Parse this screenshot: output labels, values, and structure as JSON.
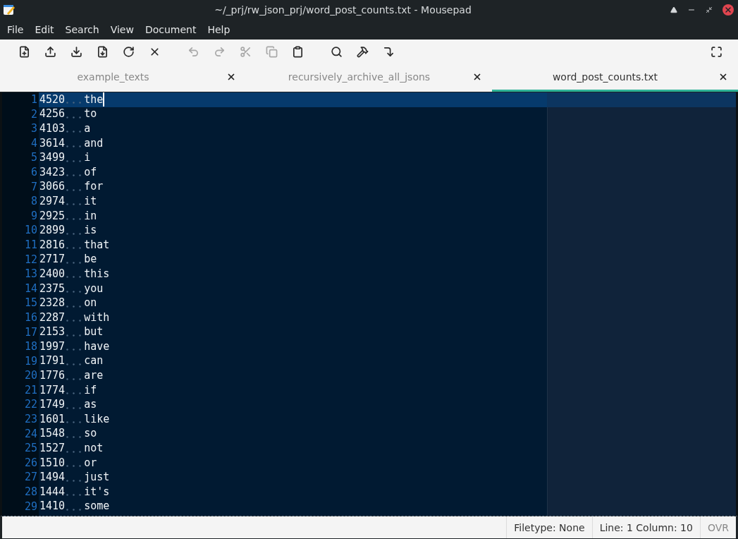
{
  "window": {
    "title": "~/_prj/rw_json_prj/word_post_counts.txt - Mousepad"
  },
  "menu": [
    "File",
    "Edit",
    "Search",
    "View",
    "Document",
    "Help"
  ],
  "toolbar": {
    "groups": [
      [
        {
          "disabled": false
        },
        {
          "disabled": false
        },
        {
          "disabled": false
        },
        {
          "disabled": false
        },
        {
          "disabled": false
        },
        {
          "disabled": false
        }
      ],
      [
        {
          "disabled": true
        },
        {
          "disabled": true
        },
        {
          "disabled": true
        },
        {
          "disabled": true
        },
        {
          "disabled": false
        }
      ],
      [
        {
          "disabled": false
        },
        {
          "disabled": false
        },
        {
          "disabled": false
        }
      ]
    ]
  },
  "tabs": [
    {
      "label": "example_texts",
      "selected": false
    },
    {
      "label": "recursively_archive_all_jsons",
      "selected": false
    },
    {
      "label": "word_post_counts.txt",
      "selected": true
    }
  ],
  "lines": [
    {
      "number": "1",
      "count": "4520",
      "word": "the",
      "current": true
    },
    {
      "number": "2",
      "count": "4256",
      "word": "to",
      "current": false
    },
    {
      "number": "3",
      "count": "4103",
      "word": "a",
      "current": false
    },
    {
      "number": "4",
      "count": "3614",
      "word": "and",
      "current": false
    },
    {
      "number": "5",
      "count": "3499",
      "word": "i",
      "current": false
    },
    {
      "number": "6",
      "count": "3423",
      "word": "of",
      "current": false
    },
    {
      "number": "7",
      "count": "3066",
      "word": "for",
      "current": false
    },
    {
      "number": "8",
      "count": "2974",
      "word": "it",
      "current": false
    },
    {
      "number": "9",
      "count": "2925",
      "word": "in",
      "current": false
    },
    {
      "number": "10",
      "count": "2899",
      "word": "is",
      "current": false
    },
    {
      "number": "11",
      "count": "2816",
      "word": "that",
      "current": false
    },
    {
      "number": "12",
      "count": "2717",
      "word": "be",
      "current": false
    },
    {
      "number": "13",
      "count": "2400",
      "word": "this",
      "current": false
    },
    {
      "number": "14",
      "count": "2375",
      "word": "you",
      "current": false
    },
    {
      "number": "15",
      "count": "2328",
      "word": "on",
      "current": false
    },
    {
      "number": "16",
      "count": "2287",
      "word": "with",
      "current": false
    },
    {
      "number": "17",
      "count": "2153",
      "word": "but",
      "current": false
    },
    {
      "number": "18",
      "count": "1997",
      "word": "have",
      "current": false
    },
    {
      "number": "19",
      "count": "1791",
      "word": "can",
      "current": false
    },
    {
      "number": "20",
      "count": "1776",
      "word": "are",
      "current": false
    },
    {
      "number": "21",
      "count": "1774",
      "word": "if",
      "current": false
    },
    {
      "number": "22",
      "count": "1749",
      "word": "as",
      "current": false
    },
    {
      "number": "23",
      "count": "1601",
      "word": "like",
      "current": false
    },
    {
      "number": "24",
      "count": "1548",
      "word": "so",
      "current": false
    },
    {
      "number": "25",
      "count": "1527",
      "word": "not",
      "current": false
    },
    {
      "number": "26",
      "count": "1510",
      "word": "or",
      "current": false
    },
    {
      "number": "27",
      "count": "1494",
      "word": "just",
      "current": false
    },
    {
      "number": "28",
      "count": "1444",
      "word": "it's",
      "current": false
    },
    {
      "number": "29",
      "count": "1410",
      "word": "some",
      "current": false
    }
  ],
  "status_bar": {
    "filetype": "Filetype: None",
    "position": "Line: 1 Column: 10",
    "mode": {
      "label": "OVR",
      "active": false
    }
  }
}
